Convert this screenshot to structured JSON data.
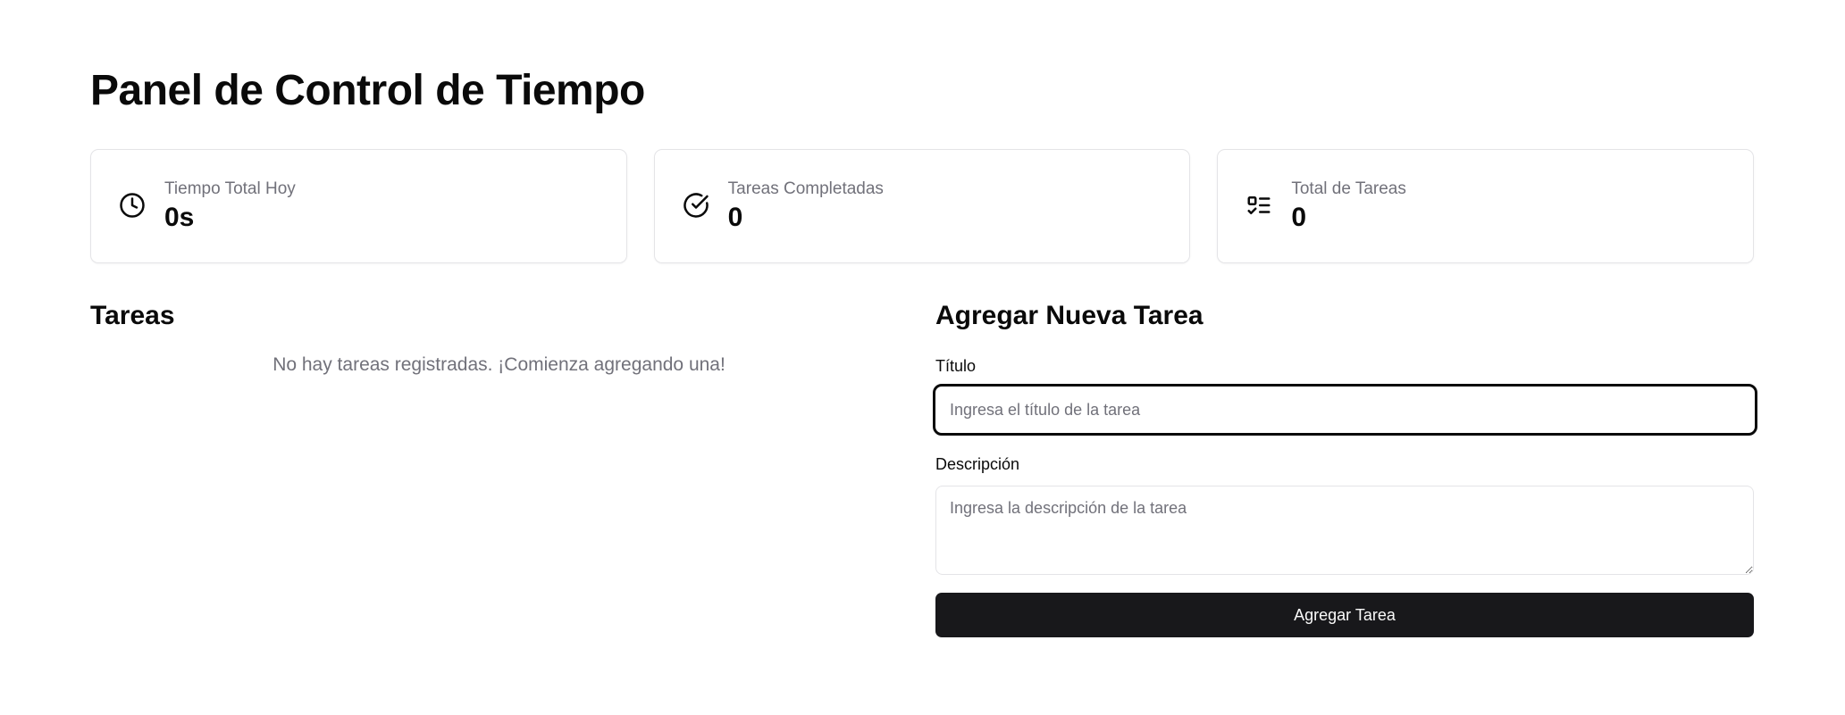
{
  "page_title": "Panel de Control de Tiempo",
  "stats": [
    {
      "icon": "clock-icon",
      "label": "Tiempo Total Hoy",
      "value": "0s"
    },
    {
      "icon": "check-circle-icon",
      "label": "Tareas Completadas",
      "value": "0"
    },
    {
      "icon": "list-checks-icon",
      "label": "Total de Tareas",
      "value": "0"
    }
  ],
  "tasks": {
    "title": "Tareas",
    "empty_message": "No hay tareas registradas. ¡Comienza agregando una!"
  },
  "form": {
    "title": "Agregar Nueva Tarea",
    "title_label": "Título",
    "title_placeholder": "Ingresa el título de la tarea",
    "title_value": "",
    "description_label": "Descripción",
    "description_placeholder": "Ingresa la descripción de la tarea",
    "description_value": "",
    "submit_label": "Agregar Tarea"
  },
  "colors": {
    "button_bg": "#18181b",
    "muted_text": "#71717a",
    "border": "#e4e4e7"
  }
}
